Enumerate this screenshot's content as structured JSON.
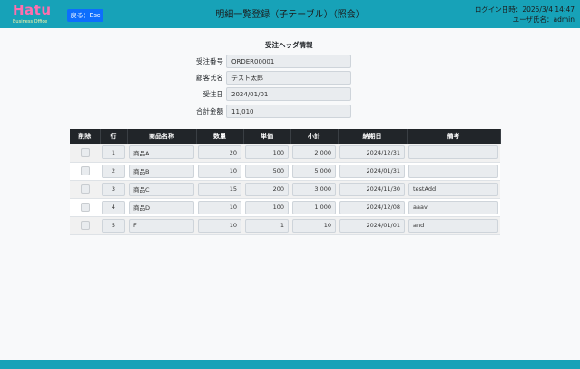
{
  "header": {
    "logo_text": "Hatu",
    "logo_sub": "Business Office",
    "back_button": "戻る：Esc",
    "title": "明細一覧登録（子テーブル）（照会）",
    "login_label": "ログイン日時：",
    "login_value": "2025/3/4 14:47",
    "user_label": "ユーザ氏名：",
    "user_value": "admin",
    "accent_color": "#17a2b8"
  },
  "order_header": {
    "section_title": "受注ヘッダ情報",
    "fields": [
      {
        "label": "受注番号",
        "value": "ORDER00001"
      },
      {
        "label": "顧客氏名",
        "value": "テスト太郎"
      },
      {
        "label": "受注日",
        "value": "2024/01/01"
      },
      {
        "label": "合計金額",
        "value": "11,010"
      }
    ]
  },
  "detail_table": {
    "columns": [
      "削除",
      "行",
      "商品名称",
      "数量",
      "単価",
      "小計",
      "納期日",
      "備考"
    ],
    "rows": [
      {
        "line": "1",
        "product": "商品A",
        "qty": "20",
        "price": "100",
        "subtotal": "2,000",
        "due": "2024/12/31",
        "note": ""
      },
      {
        "line": "2",
        "product": "商品B",
        "qty": "10",
        "price": "500",
        "subtotal": "5,000",
        "due": "2024/01/31",
        "note": ""
      },
      {
        "line": "3",
        "product": "商品C",
        "qty": "15",
        "price": "200",
        "subtotal": "3,000",
        "due": "2024/11/30",
        "note": "testAdd"
      },
      {
        "line": "4",
        "product": "商品D",
        "qty": "10",
        "price": "100",
        "subtotal": "1,000",
        "due": "2024/12/08",
        "note": "aaav"
      },
      {
        "line": "5",
        "product": "F",
        "qty": "10",
        "price": "1",
        "subtotal": "10",
        "due": "2024/01/01",
        "note": "and"
      }
    ]
  }
}
